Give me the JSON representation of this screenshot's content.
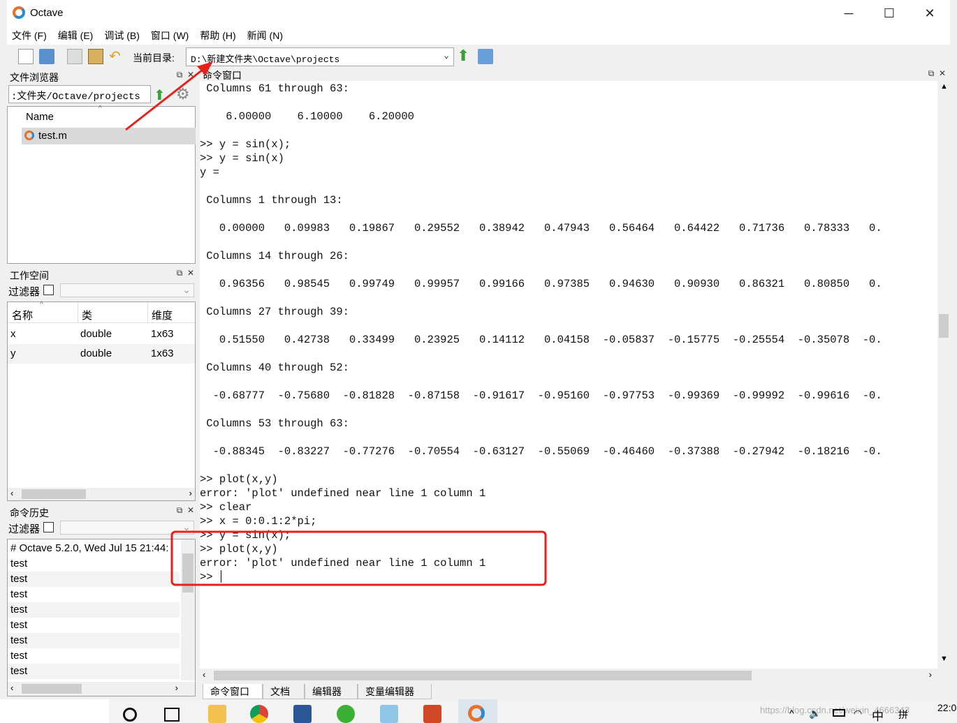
{
  "window": {
    "title": "Octave"
  },
  "menu": [
    "文件 (F)",
    "编辑 (E)",
    "调试 (B)",
    "窗口 (W)",
    "帮助 (H)",
    "新闻 (N)"
  ],
  "toolbar": {
    "dir_label": "当前目录:",
    "dir_value": "D:\\新建文件夹\\Octave\\projects"
  },
  "file_browser": {
    "title": "文件浏览器",
    "path": ":文件夹/Octave/projects",
    "col_name": "Name",
    "files": [
      "test.m"
    ]
  },
  "workspace": {
    "title": "工作空间",
    "filter_label": "过滤器",
    "columns": [
      "名称",
      "类",
      "维度"
    ],
    "rows": [
      {
        "name": "x",
        "class": "double",
        "dim": "1x63"
      },
      {
        "name": "y",
        "class": "double",
        "dim": "1x63"
      }
    ]
  },
  "history": {
    "title": "命令历史",
    "filter_label": "过滤器",
    "entries": [
      "# Octave 5.2.0, Wed Jul 15 21:44:",
      "test",
      "test",
      "test",
      "test",
      "test",
      "test",
      "test",
      "test"
    ]
  },
  "command_window": {
    "title": "命令窗口",
    "lines": [
      " Columns 61 through 63:",
      "",
      "    6.00000    6.10000    6.20000",
      "",
      ">> y = sin(x);",
      ">> y = sin(x)",
      "y =",
      "",
      " Columns 1 through 13:",
      "",
      "   0.00000   0.09983   0.19867   0.29552   0.38942   0.47943   0.56464   0.64422   0.71736   0.78333   0.",
      "",
      " Columns 14 through 26:",
      "",
      "   0.96356   0.98545   0.99749   0.99957   0.99166   0.97385   0.94630   0.90930   0.86321   0.80850   0.",
      "",
      " Columns 27 through 39:",
      "",
      "   0.51550   0.42738   0.33499   0.23925   0.14112   0.04158  -0.05837  -0.15775  -0.25554  -0.35078  -0.",
      "",
      " Columns 40 through 52:",
      "",
      "  -0.68777  -0.75680  -0.81828  -0.87158  -0.91617  -0.95160  -0.97753  -0.99369  -0.99992  -0.99616  -0.",
      "",
      " Columns 53 through 63:",
      "",
      "  -0.88345  -0.83227  -0.77276  -0.70554  -0.63127  -0.55069  -0.46460  -0.37388  -0.27942  -0.18216  -0.",
      "",
      ">> plot(x,y)",
      "error: 'plot' undefined near line 1 column 1",
      ">> clear",
      ">> x = 0:0.1:2*pi;",
      ">> y = sin(x);",
      ">> plot(x,y)",
      "error: 'plot' undefined near line 1 column 1",
      ">> "
    ]
  },
  "bottom_tabs": [
    "命令窗口",
    "文档",
    "编辑器",
    "变量编辑器"
  ],
  "taskbar": {
    "clock": "22:0",
    "ime": "中",
    "ime2": "拼",
    "watermark": "https://blog.csdn.net/weixin_4666343"
  },
  "colors": {
    "annotation_red": "#e8201a",
    "accent_green": "#3aa13a"
  }
}
